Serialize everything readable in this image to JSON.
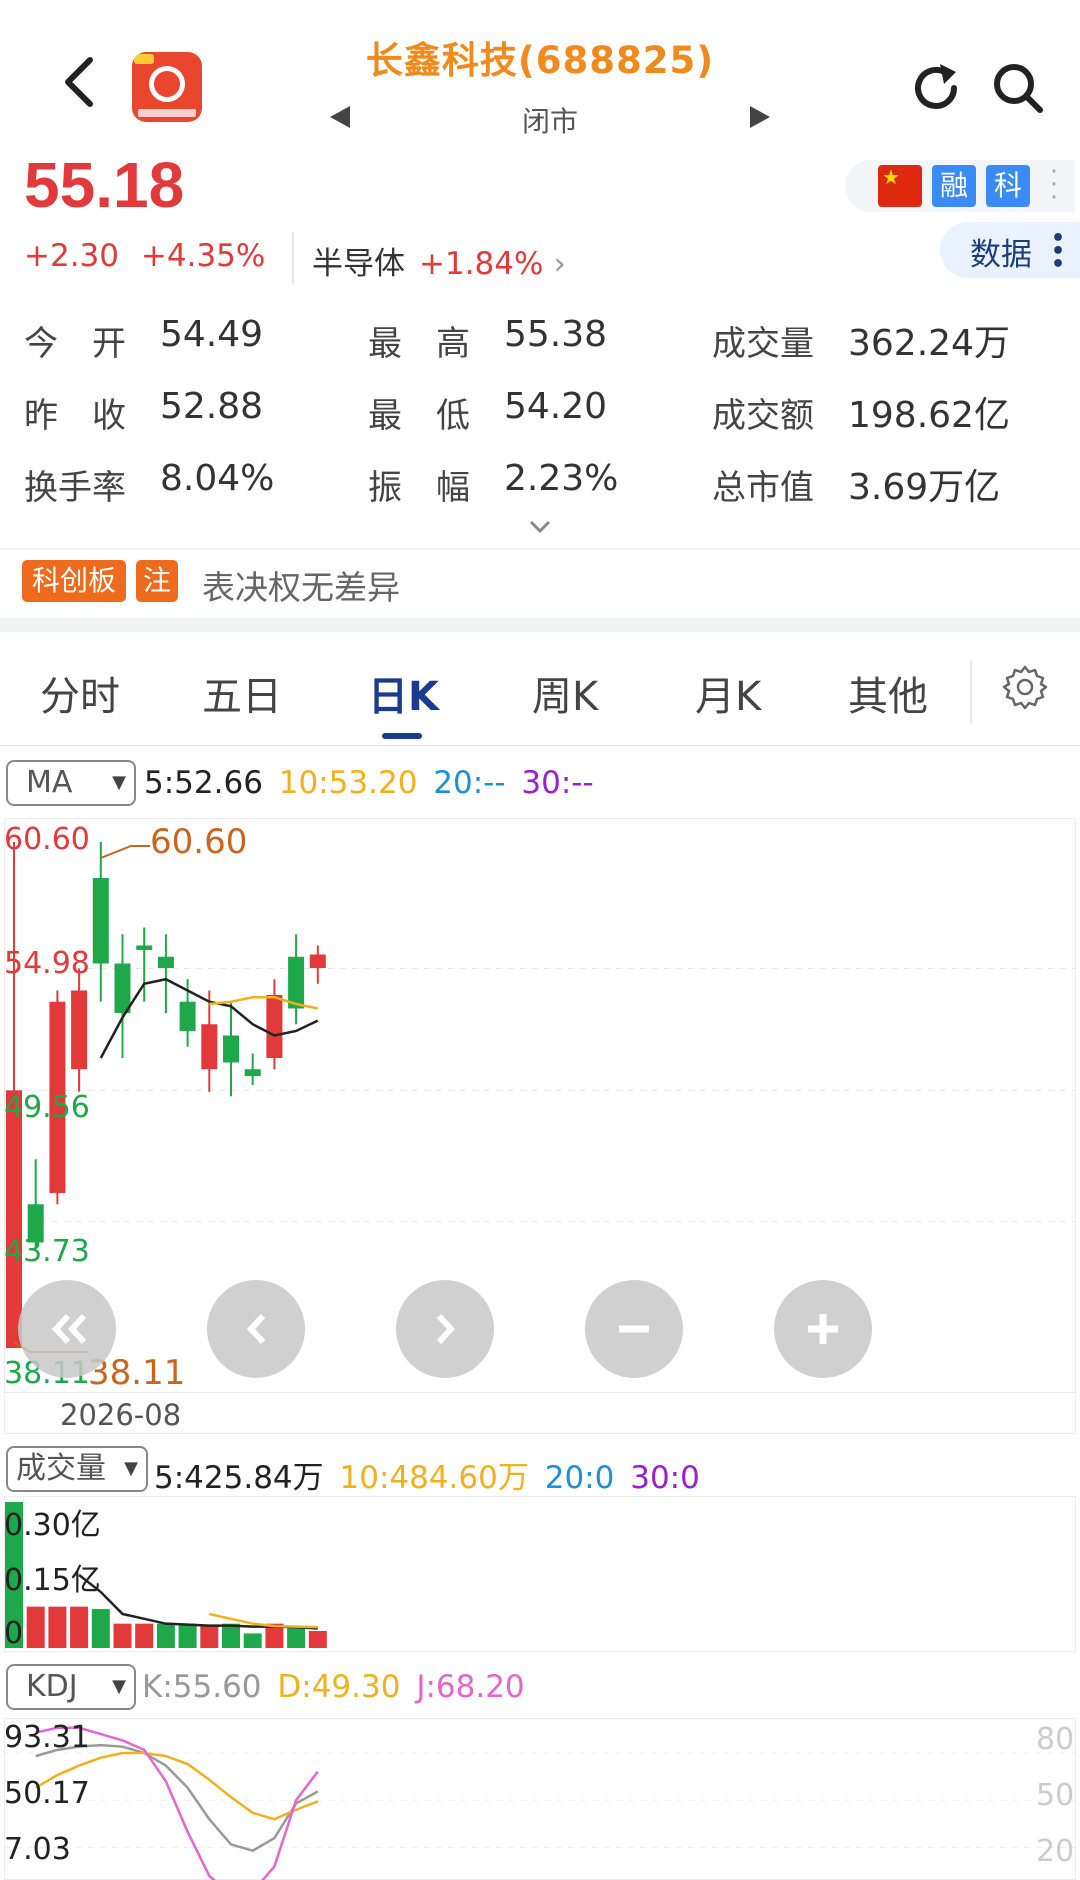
{
  "header": {
    "title": "长鑫科技(688825)",
    "status": "闭市"
  },
  "quote": {
    "price": "55.18",
    "change": "+2.30",
    "change_pct": "+4.35%",
    "sector_name": "半导体",
    "sector_pct": "+1.84%",
    "sector_chevron": "›",
    "tag_rong": "融",
    "tag_ke": "科",
    "data_btn": "数据",
    "fields": [
      {
        "label": "今　开",
        "value": "54.49"
      },
      {
        "label": "最　高",
        "value": "55.38"
      },
      {
        "label": "成交量",
        "value": "362.24万"
      },
      {
        "label": "昨　收",
        "value": "52.88"
      },
      {
        "label": "最　低",
        "value": "54.20"
      },
      {
        "label": "成交额",
        "value": "198.62亿"
      },
      {
        "label": "换手率",
        "value": "8.04%"
      },
      {
        "label": "振　幅",
        "value": "2.23%"
      },
      {
        "label": "总市值",
        "value": "3.69万亿"
      }
    ],
    "tag_kcb": "科创板",
    "tag_zhu": "注",
    "vote_text": "表决权无差异"
  },
  "tabs": [
    "分时",
    "五日",
    "日K",
    "周K",
    "月K",
    "其他"
  ],
  "active_tab": 2,
  "ma": {
    "selector": "MA",
    "ma5": "5:52.66",
    "ma10": "10:53.20",
    "ma20": "20:--",
    "ma30": "30:--"
  },
  "price_axis": {
    "max": "60.60",
    "max_note": "60.60",
    "l2": "54.98",
    "l3": "49.56",
    "l4": "43.73",
    "min": "38.11",
    "min_note": "38.11",
    "date": "2026-08"
  },
  "volume": {
    "selector": "成交量",
    "ma5": "5:425.84万",
    "ma10": "10:484.60万",
    "ma20": "20:0",
    "ma30": "30:0",
    "axis_top": "0.30亿",
    "axis_mid": "0.15亿",
    "axis_zero": "0"
  },
  "kdj": {
    "selector": "KDJ",
    "k": "K:55.60",
    "d": "D:49.30",
    "j": "J:68.20",
    "axis_top": "93.31",
    "axis_mid": "50.17",
    "axis_low": "7.03",
    "right_top": "80",
    "right_mid": "50",
    "right_low": "20"
  },
  "colors": {
    "up": "#e2393a",
    "down": "#1fa84a",
    "ma5": "#222222",
    "ma10": "#f2b01e",
    "ma20": "#1e8fd6",
    "ma30": "#9b1fd1",
    "j_line": "#e466d2",
    "k_line": "#999999",
    "d_line": "#f2b01e"
  },
  "chart_data": {
    "type": "candlestick",
    "candles": [
      {
        "o": 38.11,
        "h": 60.6,
        "l": 38.11,
        "c": 49.56
      },
      {
        "o": 44.5,
        "h": 46.5,
        "l": 42.5,
        "c": 42.8
      },
      {
        "o": 45.0,
        "h": 54.0,
        "l": 44.5,
        "c": 53.5
      },
      {
        "o": 50.5,
        "h": 54.98,
        "l": 49.5,
        "c": 54.0
      },
      {
        "o": 59.0,
        "h": 60.6,
        "l": 53.5,
        "c": 55.2
      },
      {
        "o": 55.2,
        "h": 56.5,
        "l": 51.0,
        "c": 53.0
      },
      {
        "o": 56.0,
        "h": 56.8,
        "l": 53.5,
        "c": 55.8
      },
      {
        "o": 55.5,
        "h": 56.5,
        "l": 53.0,
        "c": 55.0
      },
      {
        "o": 53.5,
        "h": 54.5,
        "l": 51.5,
        "c": 52.2
      },
      {
        "o": 50.5,
        "h": 54.0,
        "l": 49.5,
        "c": 52.5
      },
      {
        "o": 52.0,
        "h": 53.5,
        "l": 49.3,
        "c": 50.8
      },
      {
        "o": 50.5,
        "h": 51.2,
        "l": 49.8,
        "c": 50.2
      },
      {
        "o": 51.0,
        "h": 54.5,
        "l": 50.5,
        "c": 53.8
      },
      {
        "o": 55.5,
        "h": 56.5,
        "l": 52.5,
        "c": 53.2
      },
      {
        "o": 55.0,
        "h": 56.0,
        "l": 54.3,
        "c": 55.6
      }
    ],
    "ma5_line": [
      null,
      null,
      null,
      null,
      51.0,
      52.8,
      54.3,
      54.5,
      54.0,
      53.5,
      53.3,
      52.5,
      52.0,
      52.2,
      52.66
    ],
    "ma10_line": [
      null,
      null,
      null,
      null,
      null,
      null,
      null,
      null,
      null,
      53.4,
      53.5,
      53.7,
      53.7,
      53.4,
      53.2
    ],
    "volumes": [
      {
        "v": 0.3,
        "up": false
      },
      {
        "v": 0.085,
        "up": true
      },
      {
        "v": 0.085,
        "up": true
      },
      {
        "v": 0.085,
        "up": true
      },
      {
        "v": 0.08,
        "up": false
      },
      {
        "v": 0.05,
        "up": true
      },
      {
        "v": 0.05,
        "up": true
      },
      {
        "v": 0.05,
        "up": false
      },
      {
        "v": 0.05,
        "up": false
      },
      {
        "v": 0.045,
        "up": true
      },
      {
        "v": 0.05,
        "up": false
      },
      {
        "v": 0.03,
        "up": false
      },
      {
        "v": 0.05,
        "up": true
      },
      {
        "v": 0.045,
        "up": false
      },
      {
        "v": 0.035,
        "up": true
      }
    ],
    "vol_ma5": [
      null,
      null,
      null,
      0.15,
      0.115,
      0.07,
      0.06,
      0.05,
      0.048,
      0.046,
      0.046,
      0.044,
      0.044,
      0.043,
      0.04
    ],
    "vol_ma10": [
      null,
      null,
      null,
      null,
      null,
      null,
      null,
      null,
      null,
      0.07,
      0.06,
      0.05,
      0.045,
      0.044,
      0.043
    ],
    "kdj_k": [
      null,
      78,
      82,
      84,
      85,
      84,
      80,
      72,
      58,
      38,
      22,
      18,
      26,
      48,
      55.6
    ],
    "kdj_d": [
      null,
      58,
      66,
      72,
      77,
      80,
      80,
      78,
      73,
      63,
      52,
      42,
      38,
      44,
      49.3
    ],
    "kdj_j": [
      null,
      93,
      96,
      96,
      92,
      88,
      82,
      62,
      30,
      2,
      -10,
      -8,
      8,
      50,
      68.2
    ],
    "ylim_price": [
      38.11,
      60.6
    ],
    "ylim_kdj": [
      7.03,
      93.31
    ]
  }
}
